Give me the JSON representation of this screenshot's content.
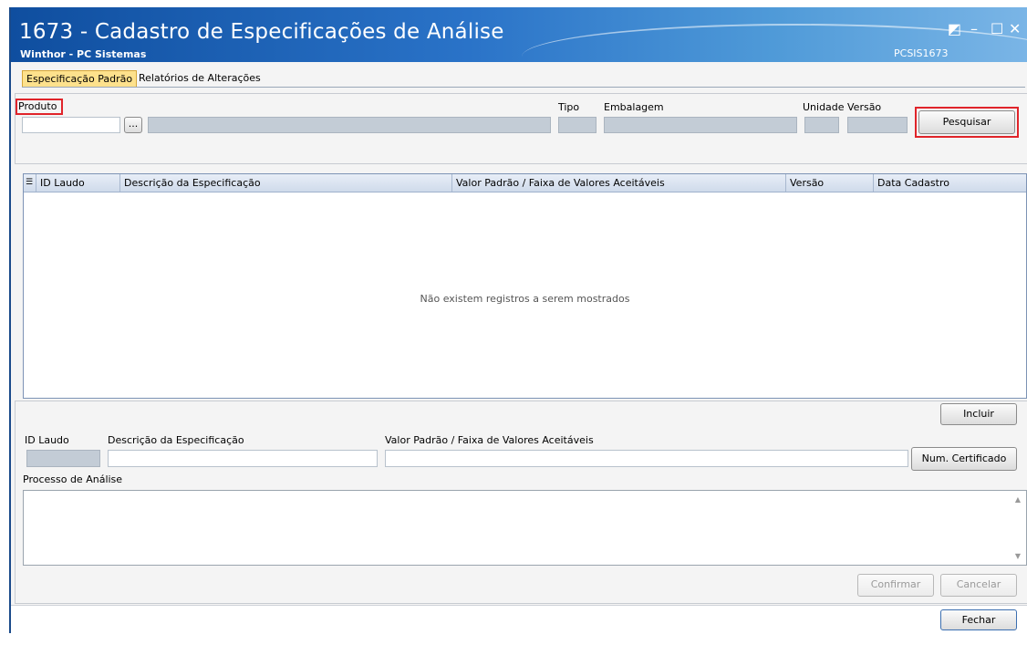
{
  "window": {
    "title": "1673 - Cadastro de Especificações de Análise",
    "subtitle": "Winthor - PC Sistemas",
    "app_code": "PCSIS1673",
    "controls": {
      "restore": "◩",
      "minimize": "–",
      "maximize": "☐",
      "close": "✕"
    }
  },
  "tabs": [
    {
      "label": "Especificação Padrão",
      "active": true
    },
    {
      "label": "Relatórios de Alterações",
      "active": false
    }
  ],
  "search": {
    "produto_label": "Produto",
    "lookup_label": "...",
    "tipo_label": "Tipo",
    "embalagem_label": "Embalagem",
    "unidade_label": "Unidade",
    "versao_label": "Versão",
    "pesquisar_label": "Pesquisar",
    "produto_value": "",
    "descricao_value": "",
    "tipo_value": "",
    "embalagem_value": "",
    "unidade_value": "",
    "versao_value": ""
  },
  "grid": {
    "columns": [
      "ID Laudo",
      "Descrição da Especificação",
      "Valor Padrão / Faixa de Valores Aceitáveis",
      "Versão",
      "Data Cadastro"
    ],
    "rows": [],
    "empty_message": "Não existem registros a serem mostrados"
  },
  "detail": {
    "incluir_label": "Incluir",
    "id_laudo_label": "ID Laudo",
    "descricao_label": "Descrição da Especificação",
    "valor_label": "Valor Padrão / Faixa de Valores Aceitáveis",
    "num_certificado_label": "Num. Certificado",
    "processo_label": "Processo de Análise",
    "confirmar_label": "Confirmar",
    "cancelar_label": "Cancelar",
    "id_laudo_value": "",
    "descricao_value": "",
    "valor_value": "",
    "processo_value": ""
  },
  "footer": {
    "fechar_label": "Fechar"
  },
  "colors": {
    "title_bar": "#1f5fad",
    "active_tab": "#fde18c",
    "highlight": "#e0242a",
    "grid_header": "#cfdbeb"
  }
}
